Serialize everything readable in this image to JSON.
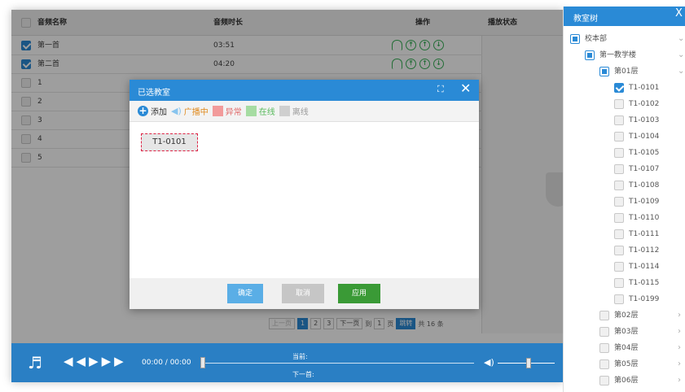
{
  "table": {
    "headers": {
      "name": "音频名称",
      "duration": "音频时长",
      "ops": "操作",
      "status": "播放状态"
    },
    "rows": [
      {
        "name": "第一首",
        "duration": "03:51",
        "checked": true,
        "has_ops": true
      },
      {
        "name": "第二首",
        "duration": "04:20",
        "checked": true,
        "has_ops": true
      },
      {
        "name": "1",
        "duration": "",
        "checked": false,
        "has_ops": false
      },
      {
        "name": "2",
        "duration": "",
        "checked": false,
        "has_ops": false
      },
      {
        "name": "3",
        "duration": "",
        "checked": false,
        "has_ops": false
      },
      {
        "name": "4",
        "duration": "",
        "checked": false,
        "has_ops": false
      },
      {
        "name": "5",
        "duration": "",
        "checked": false,
        "has_ops": false
      }
    ]
  },
  "pager": {
    "prev": "上一页",
    "pages": [
      "1",
      "2",
      "3"
    ],
    "next": "下一页",
    "to": "到",
    "page_input": "1",
    "page_unit": "页",
    "go": "跳转",
    "total": "共 16 条"
  },
  "player": {
    "time": "00:00 / 00:00",
    "current_label": "当前:",
    "next_label": "下一首:"
  },
  "modal": {
    "title": "已选教室",
    "legend": {
      "add": "添加",
      "broadcasting": "广播中",
      "abnormal": "异常",
      "online": "在线",
      "offline": "离线"
    },
    "colors": {
      "abnormal": "#f29b9b",
      "online": "#a6dca2",
      "offline": "#cfcfcf"
    },
    "selected": [
      "T1-0101"
    ],
    "buttons": {
      "ok": "确定",
      "cancel": "取消",
      "apply": "应用"
    }
  },
  "tree": {
    "title": "教室树",
    "close": "X",
    "root": "校本部",
    "building": "第一教学楼",
    "floor": "第01层",
    "rooms": [
      "T1-0101",
      "T1-0102",
      "T1-0103",
      "T1-0104",
      "T1-0105",
      "T1-0107",
      "T1-0108",
      "T1-0109",
      "T1-0110",
      "T1-0111",
      "T1-0112",
      "T1-0114",
      "T1-0115",
      "T1-0199"
    ],
    "other_floors": [
      "第02层",
      "第03层",
      "第04层",
      "第05层",
      "第06层"
    ]
  },
  "icons": {
    "player_note": "music-note-icon",
    "controls": [
      "prev-icon",
      "play-icon",
      "next-icon"
    ],
    "volume": "volume-icon"
  }
}
